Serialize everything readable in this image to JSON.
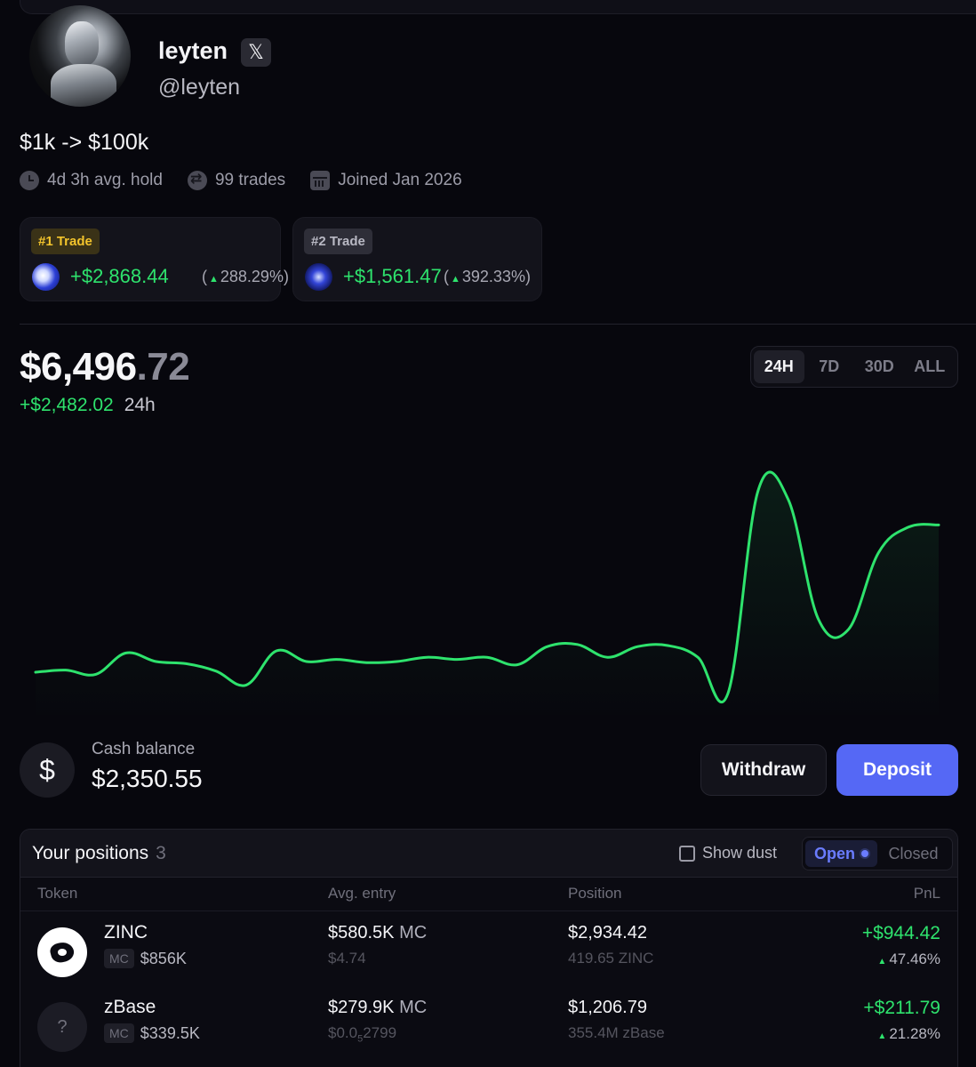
{
  "profile": {
    "name": "leyten",
    "handle": "@leyten",
    "x_icon_glyph": "𝕏",
    "bio": "$1k -> $100k",
    "avg_hold": "4d 3h avg. hold",
    "trades": "99 trades",
    "joined": "Joined Jan 2026"
  },
  "top_trades": [
    {
      "rank": "#1 Trade",
      "value": "+$2,868.44",
      "pct": "288.29%",
      "badge_color": "#f3c42c"
    },
    {
      "rank": "#2 Trade",
      "value": "+$1,561.47",
      "pct": "392.33%",
      "badge_color": "#b9b9c4"
    }
  ],
  "portfolio": {
    "value_whole": "$6,496",
    "value_cents": ".72",
    "change": "+$2,482.02",
    "period": "24h"
  },
  "ranges": [
    "24H",
    "7D",
    "30D",
    "ALL"
  ],
  "active_range": "24H",
  "chart_data": {
    "type": "area",
    "color": "#2ee36d",
    "x": [
      0,
      1,
      2,
      3,
      4,
      5,
      6,
      7,
      8,
      9,
      10,
      11,
      12,
      13,
      14,
      15,
      16,
      17,
      18,
      19,
      20,
      21,
      22,
      23,
      24,
      25,
      26,
      27,
      28,
      29,
      30,
      31,
      32,
      33,
      34,
      35,
      36,
      37,
      38,
      39,
      40,
      41,
      42,
      43,
      44,
      45,
      46,
      47,
      48,
      49,
      50
    ],
    "values": [
      100,
      110,
      90,
      190,
      150,
      140,
      105,
      40,
      200,
      150,
      160,
      145,
      150,
      170,
      160,
      170,
      135,
      220,
      230,
      170,
      220,
      225,
      170,
      0,
      950,
      910,
      350,
      300,
      660,
      780,
      790
    ],
    "ylim": [
      0,
      1000
    ],
    "grid": false
  },
  "cash": {
    "symbol": "$",
    "label": "Cash balance",
    "value": "$2,350.55"
  },
  "actions": {
    "withdraw": "Withdraw",
    "deposit": "Deposit"
  },
  "positions": {
    "title": "Your positions",
    "count": "3",
    "show_dust": "Show dust",
    "tab_open": "Open",
    "tab_closed": "Closed",
    "columns": [
      "Token",
      "Avg. entry",
      "Position",
      "PnL"
    ],
    "rows": [
      {
        "name": "ZINC",
        "mc_tag": "MC",
        "mc": "$856K",
        "entry_mc": "$580.5K",
        "entry_suffix": "MC",
        "entry_price": "$4.74",
        "position_value": "$2,934.42",
        "position_amount": "419.65 ZINC",
        "pnl": "+$944.42",
        "pnl_pct": "47.46%"
      },
      {
        "name": "zBase",
        "icon_glyph": "?",
        "mc_tag": "MC",
        "mc": "$339.5K",
        "entry_mc": "$279.9K",
        "entry_suffix": "MC",
        "entry_price_prefix": "$0.0",
        "entry_price_sub": "5",
        "entry_price_rest": "2799",
        "position_value": "$1,206.79",
        "position_amount": "355.4M zBase",
        "pnl": "+$211.79",
        "pnl_pct": "21.28%"
      }
    ]
  }
}
